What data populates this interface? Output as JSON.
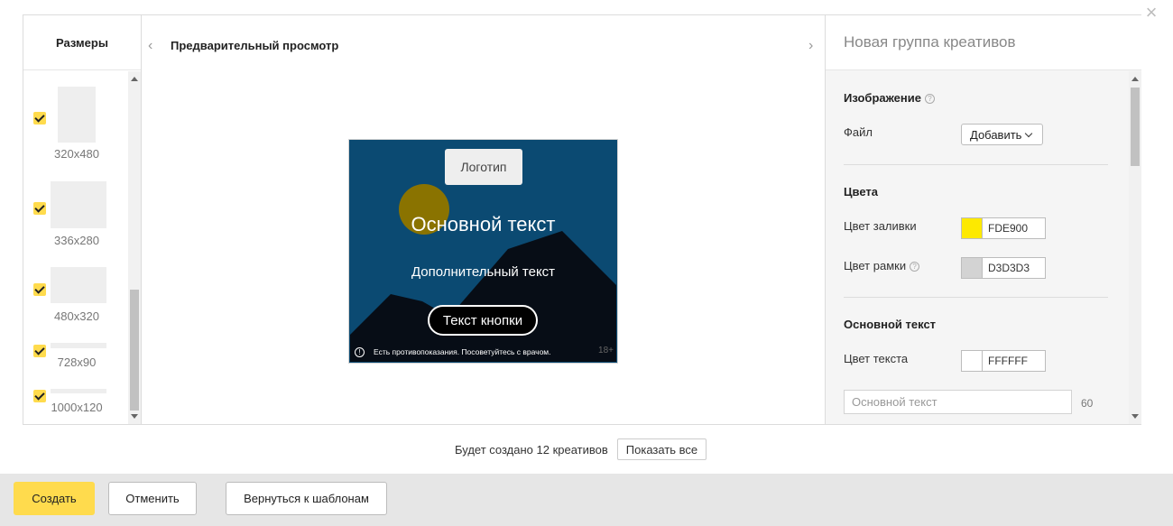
{
  "sizes": {
    "title": "Размеры",
    "items": [
      {
        "label": "320x480",
        "checked": true
      },
      {
        "label": "336x280",
        "checked": true
      },
      {
        "label": "480x320",
        "checked": true
      },
      {
        "label": "728x90",
        "checked": true
      },
      {
        "label": "1000x120",
        "checked": true
      }
    ]
  },
  "preview": {
    "title": "Предварительный просмотр",
    "prev_icon": "chevron-left-icon",
    "next_icon": "chevron-right-icon",
    "banner": {
      "logo": "Логотип",
      "main_text": "Основной текст",
      "sub_text": "Дополнительный текст",
      "cta": "Текст кнопки",
      "disclaimer": "Есть противопоказания. Посоветуйтесь с врачом.",
      "age": "18+",
      "colors": {
        "background": "#0b4a72",
        "circle": "#8a7300",
        "mountains": "#070d16"
      }
    }
  },
  "settings": {
    "title": "Новая группа креативов",
    "image_section": {
      "title": "Изображение",
      "file_label": "Файл",
      "add_button": "Добавить"
    },
    "colors_section": {
      "title": "Цвета",
      "fill_label": "Цвет заливки",
      "fill_value": "FDE900",
      "fill_color": "#FDE900",
      "border_label": "Цвет рамки",
      "border_value": "D3D3D3",
      "border_color": "#D3D3D3"
    },
    "main_text_section": {
      "title": "Основной текст",
      "text_color_label": "Цвет текста",
      "text_color_value": "FFFFFF",
      "text_color": "#FFFFFF",
      "input_placeholder": "Основной текст",
      "char_limit": "60"
    }
  },
  "summary": {
    "text": "Будет создано 12 креативов",
    "show_all": "Показать все"
  },
  "footer": {
    "create": "Создать",
    "cancel": "Отменить",
    "back": "Вернуться к шаблонам"
  },
  "accent_color": "#ffdb4d"
}
